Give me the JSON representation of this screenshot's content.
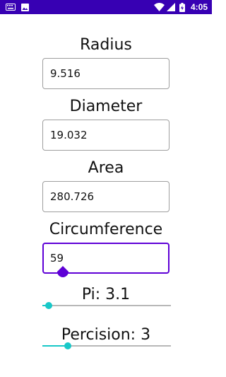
{
  "status_bar": {
    "time": "4:05",
    "left_icons": [
      "keyboard-icon",
      "image-icon"
    ],
    "right_icons": [
      "wifi-icon",
      "signal-icon",
      "battery-icon"
    ],
    "background": "#3700b3"
  },
  "radius": {
    "label": "Radius",
    "value": "9.516"
  },
  "diameter": {
    "label": "Diameter",
    "value": "19.032"
  },
  "area": {
    "label": "Area",
    "value": "280.726"
  },
  "circumference": {
    "label": "Circumference",
    "value": "59",
    "focused": true
  },
  "pi": {
    "label": "Pi: 3.1",
    "level": 0.05
  },
  "precision": {
    "label": "Percision: 3",
    "level": 0.2
  },
  "colors": {
    "accent": "#18c8c8",
    "focus": "#5e00d6"
  }
}
